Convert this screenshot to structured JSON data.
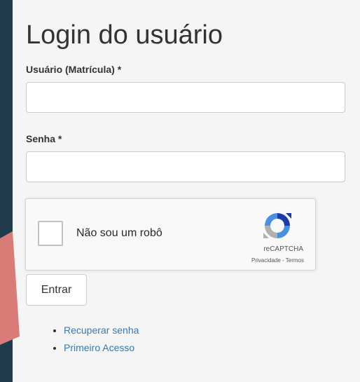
{
  "page": {
    "title": "Login do usuário"
  },
  "form": {
    "username_label": "Usuário (Matrícula) *",
    "username_value": "",
    "password_label": "Senha *",
    "password_value": "",
    "submit_label": "Entrar"
  },
  "captcha": {
    "checkbox_label": "Não sou um robô",
    "brand": "reCAPTCHA",
    "privacy_link": "Privacidade",
    "separator": " - ",
    "terms_link": "Termos"
  },
  "links": [
    {
      "label": "Recuperar senha"
    },
    {
      "label": "Primeiro Acesso"
    }
  ],
  "colors": {
    "link": "#337ab7",
    "sidebar": "#1f3b4d",
    "accent_shape": "#d97b76",
    "recaptcha_blue": "#4a90e2",
    "recaptcha_gray": "#b0b0b0"
  }
}
